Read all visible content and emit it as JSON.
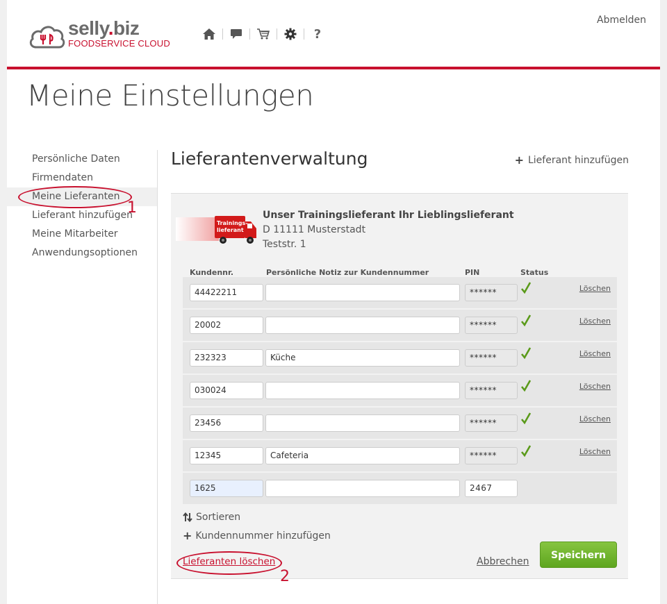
{
  "header": {
    "logo_name_main": "selly",
    "logo_name_dot": ".",
    "logo_name_tld": "biz",
    "logo_subtitle": "FOODSERVICE CLOUD",
    "logout": "Abmelden",
    "icons": [
      "home-icon",
      "chat-icon",
      "cart-icon",
      "gear-icon",
      "help-icon"
    ]
  },
  "page_title": "Meine Einstellungen",
  "sidebar": {
    "items": [
      {
        "label": "Persönliche Daten"
      },
      {
        "label": "Firmendaten"
      },
      {
        "label": "Meine Lieferanten"
      },
      {
        "label": "Lieferant hinzufügen"
      },
      {
        "label": "Meine Mitarbeiter"
      },
      {
        "label": "Anwendungsoptionen"
      }
    ],
    "active_index": 2
  },
  "section": {
    "title": "Lieferantenverwaltung",
    "add_supplier": "Lieferant hinzufügen"
  },
  "supplier": {
    "logo_text_1": "Trainings-",
    "logo_text_2": "lieferant",
    "name": "Unser Trainingslieferant Ihr Lieblingslieferant",
    "city": "D 11111 Musterstadt",
    "street": "Teststr. 1"
  },
  "columns": {
    "customer_no": "Kundennr.",
    "note": "Persönliche Notiz zur Kundennummer",
    "pin": "PIN",
    "status": "Status"
  },
  "rows": [
    {
      "customer_no": "44422211",
      "note": "",
      "pin": "******",
      "delete": "Löschen"
    },
    {
      "customer_no": "20002",
      "note": "",
      "pin": "******",
      "delete": "Löschen"
    },
    {
      "customer_no": "232323",
      "note": "Küche",
      "pin": "******",
      "delete": "Löschen"
    },
    {
      "customer_no": "030024",
      "note": "",
      "pin": "******",
      "delete": "Löschen"
    },
    {
      "customer_no": "23456",
      "note": "",
      "pin": "******",
      "delete": "Löschen"
    },
    {
      "customer_no": "12345",
      "note": "Cafeteria",
      "pin": "******",
      "delete": "Löschen"
    },
    {
      "customer_no": "1625",
      "note": "",
      "pin": "2467"
    }
  ],
  "actions": {
    "sort": "Sortieren",
    "add_customer_no": "Kundennummer hinzufügen",
    "delete_supplier": "Lieferanten löschen",
    "cancel": "Abbrechen",
    "save": "Speichern"
  },
  "annotations": {
    "marker_1": "1",
    "marker_2": "2"
  },
  "colors": {
    "brand_red": "#c8102e",
    "save_green": "#6db22a",
    "check_green": "#5a9a1a"
  }
}
